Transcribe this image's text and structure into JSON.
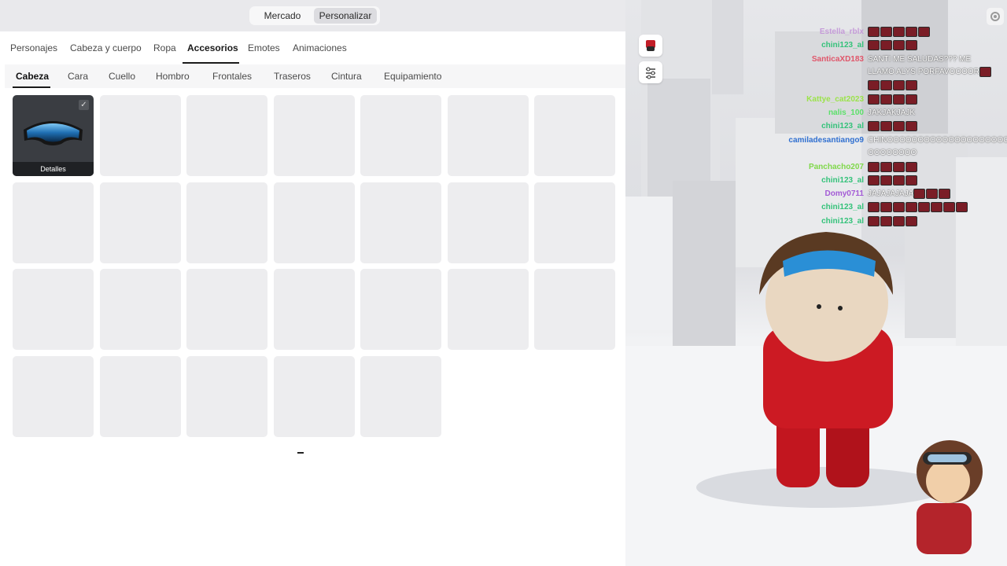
{
  "top_tabs": {
    "market": "Mercado",
    "customize": "Personalizar"
  },
  "categories": [
    "Personajes",
    "Cabeza y cuerpo",
    "Ropa",
    "Accesorios",
    "Emotes",
    "Animaciones"
  ],
  "active_category": "Accesorios",
  "subcategories": [
    "Cabeza",
    "Cara",
    "Cuello",
    "Hombro",
    "Frontales",
    "Traseros",
    "Cintura",
    "Equipamiento"
  ],
  "active_subcategory": "Cabeza",
  "owned_item": {
    "label": "Detalles",
    "equipped": true
  },
  "chat": [
    {
      "name": "Estella_rblx",
      "color": "#c59bd8",
      "message": "",
      "emotes": 5
    },
    {
      "name": "chini123_al",
      "color": "#34c27a",
      "message": "",
      "emotes": 4
    },
    {
      "name": "SanticaXD183",
      "color": "#e0566a",
      "message": "SANTI ME SALUDAS??? ME",
      "emotes": 0
    },
    {
      "name": "",
      "color": "#ffffff",
      "message": "LLAMO ALYS PORFAVOOOOR",
      "emotes": 1
    },
    {
      "name": "",
      "color": "#ffffff",
      "message": "",
      "emotes": 4
    },
    {
      "name": "Kattye_cat2023",
      "color": "#9be34a",
      "message": "",
      "emotes": 4
    },
    {
      "name": "nalis_100",
      "color": "#5ce06a",
      "message": "JAKJAKJAJK",
      "emotes": 0
    },
    {
      "name": "chini123_al",
      "color": "#34c27a",
      "message": "",
      "emotes": 4
    },
    {
      "name": "camiladesantiango9",
      "color": "#2f6fd0",
      "message": "CHINOOOOOOOOOOOOOOOOOOOO",
      "emotes": 0
    },
    {
      "name": "",
      "color": "#ffffff",
      "message": "OOOOOOOO",
      "emotes": 0
    },
    {
      "name": "Panchacho207",
      "color": "#7fd84a",
      "message": "",
      "emotes": 4
    },
    {
      "name": "chini123_al",
      "color": "#34c27a",
      "message": "",
      "emotes": 4
    },
    {
      "name": "Domy0711",
      "color": "#a35ad6",
      "message": "JAJAJAJAJA",
      "emotes": 3
    },
    {
      "name": "chini123_al",
      "color": "#34c27a",
      "message": "",
      "emotes": 8
    },
    {
      "name": "chini123_al",
      "color": "#34c27a",
      "message": "",
      "emotes": 4
    }
  ]
}
